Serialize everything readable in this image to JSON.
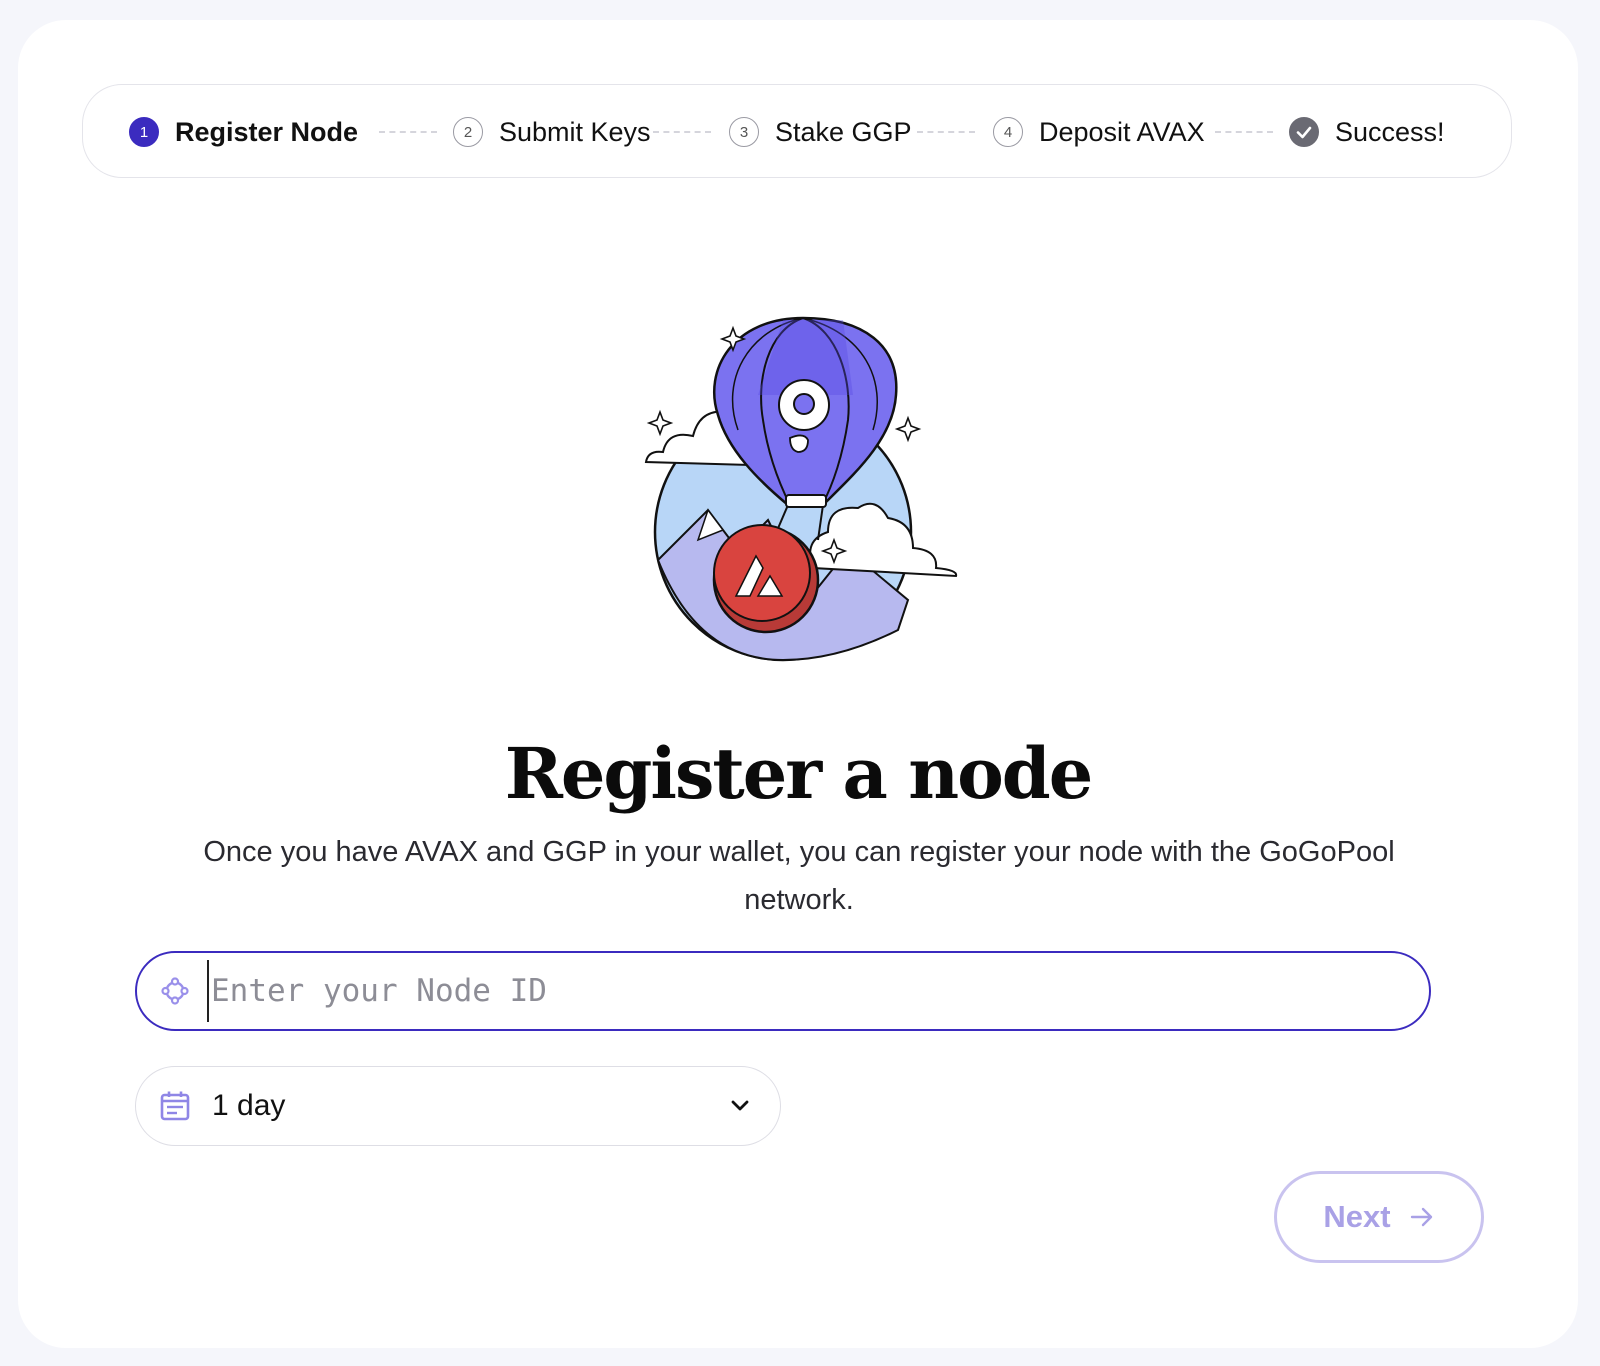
{
  "stepper": {
    "steps": [
      {
        "number": "1",
        "label": "Register Node",
        "state": "active"
      },
      {
        "number": "2",
        "label": "Submit Keys",
        "state": "pending"
      },
      {
        "number": "3",
        "label": "Stake GGP",
        "state": "pending"
      },
      {
        "number": "4",
        "label": "Deposit AVAX",
        "state": "pending"
      },
      {
        "number": "",
        "label": "Success!",
        "state": "final",
        "icon": "check-icon"
      }
    ]
  },
  "hero": {
    "icon": "balloon-illustration",
    "title": "Register a node",
    "description": "Once you have AVAX and GGP in your wallet, you can register your node with the GoGoPool network."
  },
  "form": {
    "node_id": {
      "icon": "node-icon",
      "value": "",
      "placeholder": "Enter your Node ID"
    },
    "duration": {
      "icon": "calendar-icon",
      "selected": "1 day",
      "dropdown_icon": "chevron-down-icon"
    },
    "next_button": {
      "label": "Next",
      "icon": "arrow-right-icon"
    }
  },
  "colors": {
    "accent": "#3b2bbf",
    "disabled_button_text": "#a9a1e6",
    "page_background": "#f5f6fb"
  }
}
